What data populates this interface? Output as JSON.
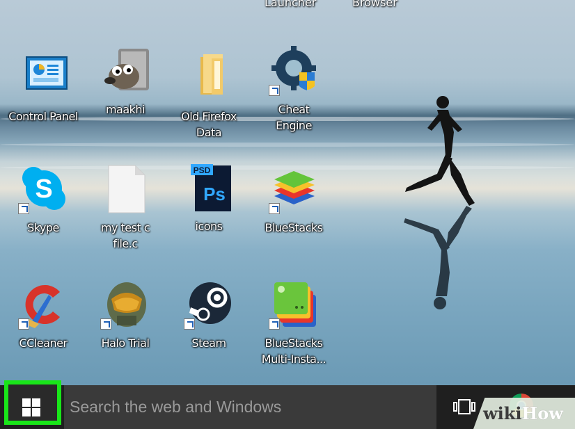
{
  "desktop": {
    "top_labels": [
      "Launcher",
      "Browser"
    ],
    "icons": [
      {
        "label": "Control Panel",
        "icon": "control-panel-icon"
      },
      {
        "label": "maakhi",
        "icon": "gimp-icon"
      },
      {
        "label": "Old Firefox Data",
        "icon": "folder-icon"
      },
      {
        "label": "Cheat Engine",
        "icon": "cheat-engine-icon"
      },
      {
        "label": "Skype",
        "icon": "skype-icon"
      },
      {
        "label": "my test c file.c",
        "icon": "file-icon"
      },
      {
        "label": "icons",
        "icon": "photoshop-icon"
      },
      {
        "label": "BlueStacks",
        "icon": "bluestacks-icon"
      },
      {
        "label": "CCleaner",
        "icon": "ccleaner-icon"
      },
      {
        "label": "Halo Trial",
        "icon": "halo-icon"
      },
      {
        "label": "Steam",
        "icon": "steam-icon"
      },
      {
        "label": "BlueStacks Multi-Insta...",
        "icon": "bluestacks-multi-icon"
      }
    ]
  },
  "taskbar": {
    "search_placeholder": "Search the web and Windows",
    "start_highlight_color": "#19e619"
  },
  "watermark": {
    "wiki": "wiki",
    "how": "How"
  }
}
